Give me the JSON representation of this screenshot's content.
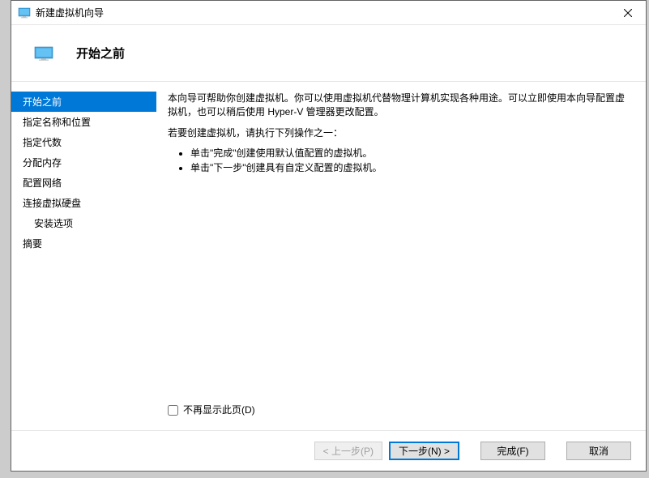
{
  "window": {
    "title": "新建虚拟机向导"
  },
  "header": {
    "title": "开始之前"
  },
  "sidebar": {
    "items": [
      {
        "label": "开始之前",
        "selected": true
      },
      {
        "label": "指定名称和位置"
      },
      {
        "label": "指定代数"
      },
      {
        "label": "分配内存"
      },
      {
        "label": "配置网络"
      },
      {
        "label": "连接虚拟硬盘"
      },
      {
        "label": "安装选项",
        "indent": true
      },
      {
        "label": "摘要"
      }
    ]
  },
  "content": {
    "para1": "本向导可帮助你创建虚拟机。你可以使用虚拟机代替物理计算机实现各种用途。可以立即使用本向导配置虚拟机，也可以稍后使用 Hyper-V 管理器更改配置。",
    "para2": "若要创建虚拟机，请执行下列操作之一：",
    "bullets": [
      "单击\"完成\"创建使用默认值配置的虚拟机。",
      "单击\"下一步\"创建具有自定义配置的虚拟机。"
    ],
    "checkbox_label": "不再显示此页(D)"
  },
  "footer": {
    "prev": "< 上一步(P)",
    "next": "下一步(N) >",
    "finish": "完成(F)",
    "cancel": "取消"
  }
}
